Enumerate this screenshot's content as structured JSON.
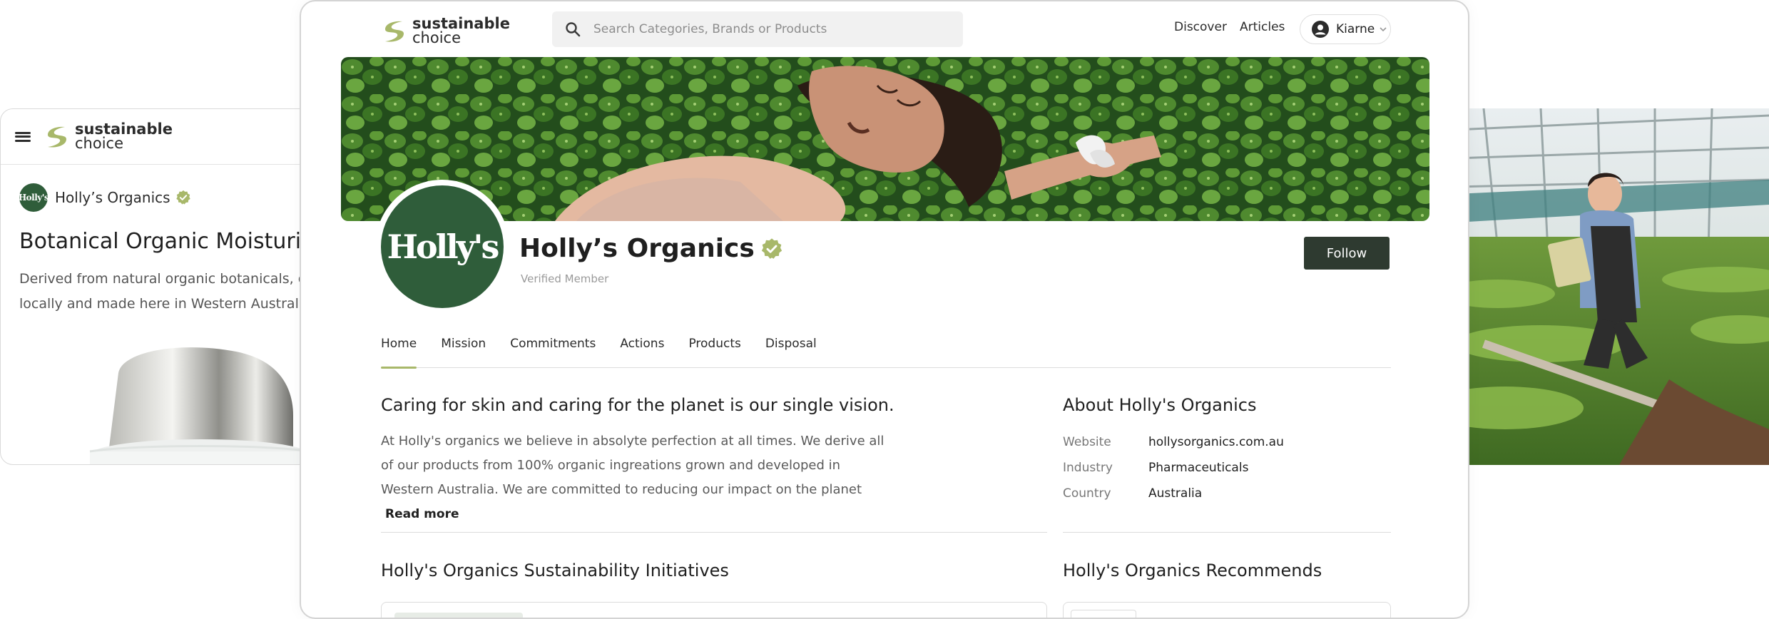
{
  "brand": {
    "logo_line1": "sustainable",
    "logo_line2": "choice",
    "accent_color": "#a8b86a",
    "dark_green": "#2f5d3a"
  },
  "mobile": {
    "brand_name": "Holly’s Organics",
    "avatar_text": "Holly's",
    "product_title": "Botanical Organic Moisturi",
    "description": "Derived from natural organic botanicals, grown locally and made here in Western Australia."
  },
  "header": {
    "search_placeholder": "Search Categories, Brands or Products",
    "nav": [
      "Discover",
      "Articles"
    ],
    "user_name": "Kiarne"
  },
  "profile": {
    "avatar_text": "Holly's",
    "name": "Holly’s Organics",
    "subtitle": "Verified Member",
    "follow_label": "Follow"
  },
  "tabs": [
    "Home",
    "Mission",
    "Commitments",
    "Actions",
    "Products",
    "Disposal"
  ],
  "vision": {
    "heading": "Caring for skin and caring for the planet is our single vision.",
    "body": "At Holly's organics we believe in absolyte perfection at all times. We derive all of our products from 100% organic ingreations grown and developed in Western Australia. We are committed to reducing our impact on the planet",
    "read_more": "Read more"
  },
  "about": {
    "heading": "About Holly's Organics",
    "rows": [
      {
        "key": "Website",
        "value": "hollysorganics.com.au"
      },
      {
        "key": "Industry",
        "value": "Pharmaceuticals"
      },
      {
        "key": "Country",
        "value": "Australia"
      }
    ]
  },
  "sections": {
    "initiatives_heading": "Holly's Organics Sustainability Initiatives",
    "recommends_heading": "Holly's Organics Recommends"
  }
}
